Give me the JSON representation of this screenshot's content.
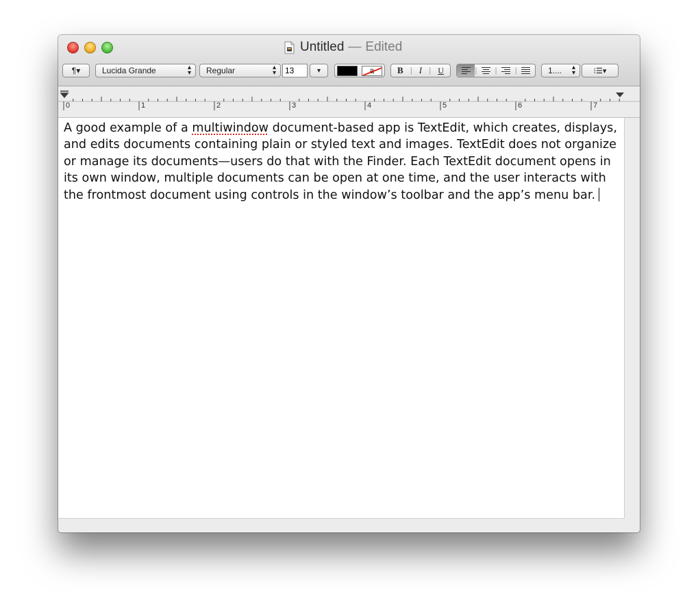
{
  "window": {
    "title": "Untitled",
    "title_separator": "—",
    "status": "Edited"
  },
  "toolbar": {
    "paragraph_menu": "¶▾",
    "font_family": "Lucida Grande",
    "font_style": "Regular",
    "font_size": "13",
    "size_dropdown": "▾",
    "text_color": "#000000",
    "background_color_glyph": "a",
    "bold": "B",
    "italic": "I",
    "underline": "U",
    "separator": "|",
    "spacing": "1....",
    "lists": "⁝☰▾"
  },
  "ruler": {
    "labels": [
      "0",
      "1",
      "2",
      "3",
      "4",
      "5",
      "6",
      "7"
    ]
  },
  "document": {
    "text_before": "A good example of a ",
    "misspelled_word": "multiwindow",
    "text_after": " document-based app is TextEdit, which creates, displays, and edits documents containing plain or styled text and images. TextEdit does not organize or manage its documents—users do that with the Finder. Each TextEdit document opens in its own window, multiple documents can be open at one time, and the user interacts with the frontmost document using controls in the window’s toolbar and the app’s menu bar."
  },
  "colors": {
    "close": "#e5443a",
    "minimize": "#f0b12a",
    "zoom": "#55c13f",
    "spellcheck_underline": "#dd2222"
  }
}
